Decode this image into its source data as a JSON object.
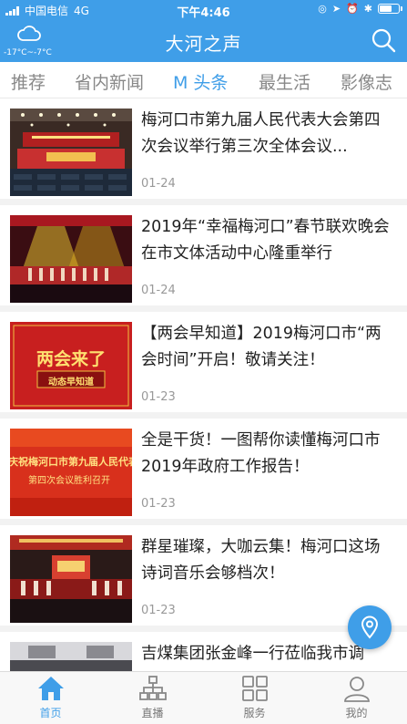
{
  "status_bar": {
    "carrier": "中国电信",
    "network": "4G",
    "time": "下午4:46"
  },
  "header": {
    "weather_icon": "cloud-icon",
    "temperature": "-17°C~-7°C",
    "title": "大河之声",
    "search_icon": "search-icon"
  },
  "tabs": [
    {
      "label": "推荐",
      "active": false
    },
    {
      "label": "省内新闻",
      "active": false
    },
    {
      "label": "M 头条",
      "active": true
    },
    {
      "label": "最生活",
      "active": false
    },
    {
      "label": "影像志",
      "active": false
    }
  ],
  "news": [
    {
      "title": "梅河口市第九届人民代表大会第四次会议举行第三次全体会议...",
      "date": "01-24",
      "thumb_text": ""
    },
    {
      "title": "2019年“幸福梅河口”春节联欢晚会在市文体活动中心隆重举行",
      "date": "01-24",
      "thumb_text": ""
    },
    {
      "title": "【两会早知道】2019梅河口市“两会时间”开启！敬请关注！",
      "date": "01-23",
      "thumb_text": "两会来了",
      "thumb_sub": "动态早知道"
    },
    {
      "title": "全是干货！一图帮你读懂梅河口市2019年政府工作报告！",
      "date": "01-23",
      "thumb_text": "庆祝梅河口市第九届人民代表",
      "thumb_sub": "第四次会议胜利召开"
    },
    {
      "title": "群星璀璨，大咖云集！梅河口这场诗词音乐会够档次！",
      "date": "01-23",
      "thumb_text": ""
    },
    {
      "title": "吉煤集团张金峰一行莅临我市调",
      "date": "",
      "thumb_text": ""
    }
  ],
  "bottom_nav": [
    {
      "label": "首页",
      "icon": "home-icon",
      "active": true
    },
    {
      "label": "直播",
      "icon": "live-network-icon",
      "active": false
    },
    {
      "label": "服务",
      "icon": "grid-services-icon",
      "active": false
    },
    {
      "label": "我的",
      "icon": "user-icon",
      "active": false
    }
  ],
  "colors": {
    "accent": "#3f9ee8",
    "header_bg": "#3f9ee8",
    "inactive_text": "#888888"
  }
}
